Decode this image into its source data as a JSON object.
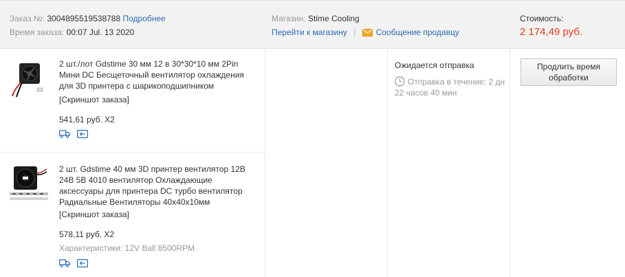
{
  "order": {
    "number_label": "Заказ №:",
    "number_value": "3004895519538788",
    "details_link": "Подробнее",
    "time_label": "Время заказа:",
    "time_value": "00:07 Jul. 13 2020"
  },
  "store": {
    "label": "Магазин:",
    "name": "Stime Cooling",
    "goto_link": "Перейти к магазину",
    "separator": "|",
    "message_link": "Сообщение продавцу"
  },
  "cost": {
    "label": "Стоимость:",
    "value": "2 174,49 руб."
  },
  "items": [
    {
      "title": "2 шт./лот Gdstime 30 мм 12 в 30*30*10 мм 2Pin Мини DC Бесщеточный вентилятор охлаждения для 3D принтера с шарикоподшипником",
      "snapshot": "[Скриншот заказа]",
      "price": "541,61 руб. X2"
    },
    {
      "title": "2 шт. Gdstime 40 мм 3D принтер вентилятор 12В 24В 5В 4010 вентилятор Охлаждающие аксессуары для принтера DC турбо вентилятор Радиальные Вентиляторы 40x40x10мм",
      "snapshot": "[Скриншот заказа]",
      "price": "578,11 руб. X2",
      "characteristics": "Характеристики: 12V Ball 8500RPM"
    }
  ],
  "status": {
    "title": "Ожидается отправка",
    "countdown": "Отправка в течение: 2 дн 22 часов 40 мин"
  },
  "action": {
    "extend_button": "Продлить время обработки"
  },
  "icons": {
    "shipping": "truck-icon",
    "returns": "return-icon",
    "mail": "envelope-icon",
    "clock": "clock-icon"
  },
  "colors": {
    "link": "#2a6bb5",
    "price": "#e53c1c",
    "mail_icon": "#f5a623",
    "header_bg": "#f2f2f2"
  }
}
